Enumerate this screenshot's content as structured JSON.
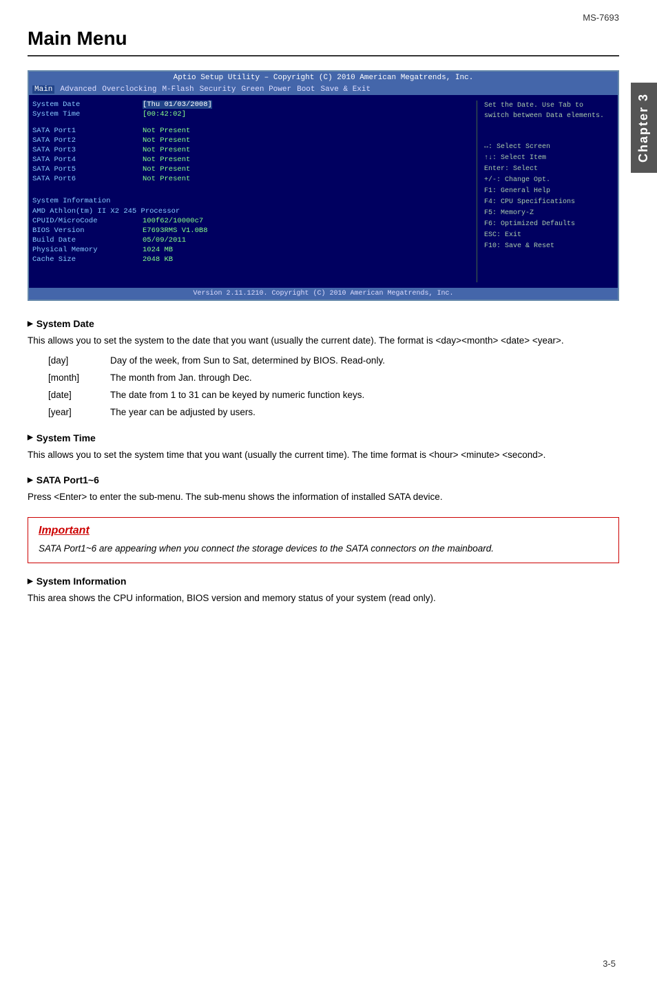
{
  "model": "MS-7693",
  "page_title": "Main Menu",
  "chapter_label": "Chapter 3",
  "page_number": "3-5",
  "bios": {
    "title_bar": "Aptio Setup Utility – Copyright (C) 2010 American Megatrends, Inc.",
    "nav_items": [
      "Main",
      "Advanced",
      "Overclocking",
      "M-Flash",
      "Security",
      "Green Power",
      "Boot",
      "Save & Exit"
    ],
    "active_nav": "Main",
    "fields": [
      {
        "label": "System Date",
        "value": "[Thu 01/03/2008]"
      },
      {
        "label": "System Time",
        "value": "[00:42:02]"
      }
    ],
    "sata_ports": [
      {
        "label": "SATA Port1",
        "value": "Not Present"
      },
      {
        "label": "SATA Port2",
        "value": "Not Present"
      },
      {
        "label": "SATA Port3",
        "value": "Not Present"
      },
      {
        "label": "SATA Port4",
        "value": "Not Present"
      },
      {
        "label": "SATA Port5",
        "value": "Not Present"
      },
      {
        "label": "SATA Port6",
        "value": "Not Present"
      }
    ],
    "system_info_title": "System Information",
    "system_info_cpu": "AMD Athlon(tm) II X2 245 Processor",
    "system_info_fields": [
      {
        "label": "CPUID/MicroCode",
        "value": "100f62/10000c7"
      },
      {
        "label": "BIOS Version",
        "value": "E7693RMS V1.0B8"
      },
      {
        "label": "Build Date",
        "value": "05/09/2011"
      },
      {
        "label": "Physical Memory",
        "value": "1024 MB"
      },
      {
        "label": "Cache Size",
        "value": "2048 KB"
      }
    ],
    "help_text": "Set the Date. Use Tab to\nswitch between Data elements.",
    "keys": [
      "↔: Select Screen",
      "↑↓: Select Item",
      "Enter: Select",
      "+/-: Change Opt.",
      "F1: General Help",
      "F4: CPU Specifications",
      "F5: Memory-Z",
      "F6: Optimized Defaults",
      "ESC: Exit",
      "F10: Save & Reset"
    ],
    "footer": "Version 2.11.1210. Copyright (C) 2010 American Megatrends, Inc."
  },
  "sections": [
    {
      "id": "system-date",
      "heading": "System Date",
      "text": "This allows you to set the system to the date that you want (usually the current date). The format is <day><month> <date> <year>.",
      "params": [
        {
          "key": "[day]",
          "value": "Day of the week, from Sun to Sat, determined by BIOS. Read-only."
        },
        {
          "key": "[month]",
          "value": "The month from Jan. through Dec."
        },
        {
          "key": "[date]",
          "value": "The date from 1 to 31 can be keyed by numeric function keys."
        },
        {
          "key": "[year]",
          "value": "The year can be adjusted by users."
        }
      ]
    },
    {
      "id": "system-time",
      "heading": "System Time",
      "text": "This allows you to set the system time that you want (usually the current time). The time format is <hour> <minute> <second>.",
      "params": []
    },
    {
      "id": "sata-port",
      "heading": "SATA Port1~6",
      "text": "Press <Enter> to enter the sub-menu. The sub-menu shows the information of installed SATA device.",
      "params": []
    },
    {
      "id": "system-info",
      "heading": "System Information",
      "text": "This area shows the CPU information, BIOS version and memory status of your system (read only).",
      "params": []
    }
  ],
  "important": {
    "title": "Important",
    "text": "SATA Port1~6 are appearing when you connect the storage devices to the SATA connectors on the mainboard."
  }
}
